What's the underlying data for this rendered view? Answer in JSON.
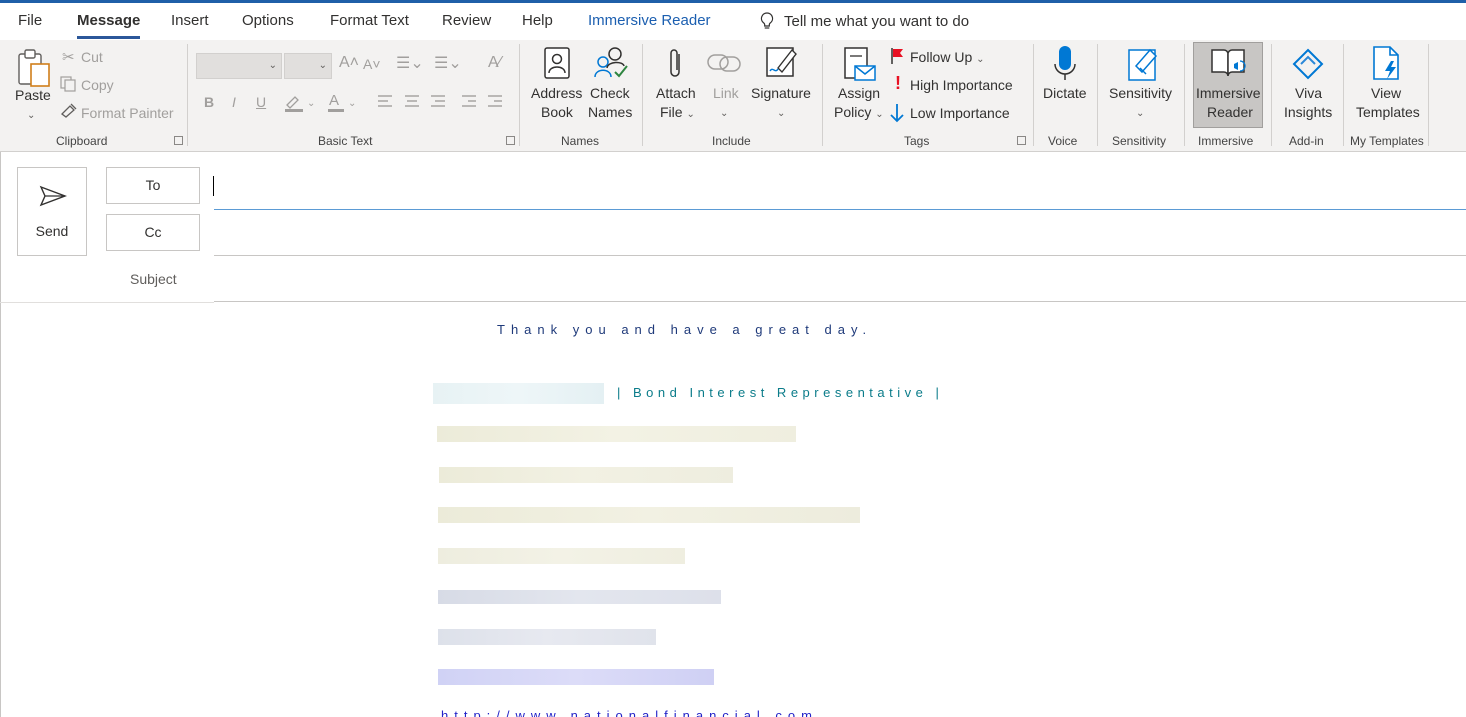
{
  "menu": {
    "tabs": [
      "File",
      "Message",
      "Insert",
      "Options",
      "Format Text",
      "Review",
      "Help",
      "Immersive Reader"
    ],
    "tell_me": "Tell me what you want to do"
  },
  "ribbon": {
    "clipboard": {
      "paste": "Paste",
      "cut": "Cut",
      "copy": "Copy",
      "format_painter": "Format Painter",
      "label": "Clipboard"
    },
    "basic_text": {
      "bold": "B",
      "italic": "I",
      "underline": "U",
      "label": "Basic Text"
    },
    "names": {
      "address_book_1": "Address",
      "address_book_2": "Book",
      "check_names_1": "Check",
      "check_names_2": "Names",
      "label": "Names"
    },
    "include": {
      "attach_1": "Attach",
      "attach_2": "File",
      "link": "Link",
      "signature": "Signature",
      "label": "Include"
    },
    "tags": {
      "assign_1": "Assign",
      "assign_2": "Policy",
      "follow_up": "Follow Up",
      "high_importance": "High Importance",
      "low_importance": "Low Importance",
      "label": "Tags"
    },
    "voice": {
      "dictate": "Dictate",
      "label": "Voice"
    },
    "sensitivity": {
      "button": "Sensitivity",
      "label": "Sensitivity"
    },
    "immersive": {
      "button_1": "Immersive",
      "button_2": "Reader",
      "label": "Immersive"
    },
    "addin": {
      "button_1": "Viva",
      "button_2": "Insights",
      "label": "Add-in"
    },
    "templates": {
      "button_1": "View",
      "button_2": "Templates",
      "label": "My Templates"
    }
  },
  "compose": {
    "send": "Send",
    "to": "To",
    "cc": "Cc",
    "subject": "Subject"
  },
  "body": {
    "thanks": "Thank you and have a great day.",
    "role": "| Bond Interest Representative |",
    "url": "http://www.nationalfinancial.com"
  },
  "colors": {
    "accent": "#2b579a",
    "immersive_tab": "#1c5fb0",
    "thanks_text": "#1f3a7a",
    "role_text": "#0b7c8a",
    "link": "#2323c8"
  }
}
